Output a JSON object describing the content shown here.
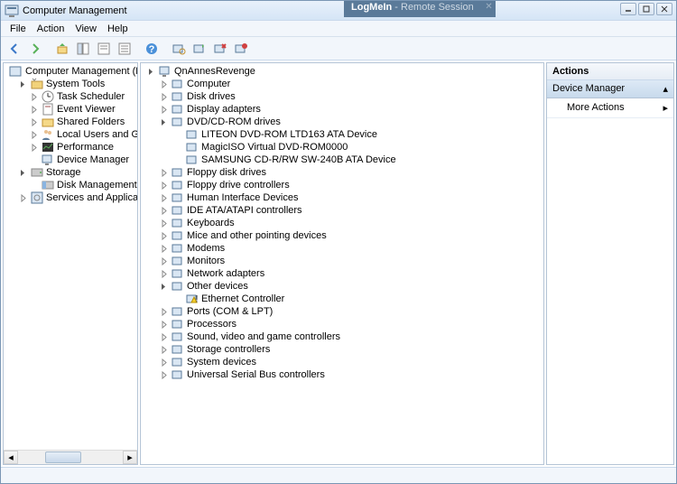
{
  "window": {
    "title": "Computer Management",
    "remote_app": "LogMeIn",
    "remote_suffix": " - Remote Session"
  },
  "menu": [
    "File",
    "Action",
    "View",
    "Help"
  ],
  "leftTree": {
    "root": "Computer Management (Local",
    "groups": [
      {
        "label": "System Tools",
        "children": [
          "Task Scheduler",
          "Event Viewer",
          "Shared Folders",
          "Local Users and Groups",
          "Performance",
          "Device Manager"
        ]
      },
      {
        "label": "Storage",
        "children": [
          "Disk Management"
        ]
      },
      {
        "label": "Services and Applications",
        "children": []
      }
    ]
  },
  "devTree": {
    "root": "QnAnnesRevenge",
    "cats": [
      {
        "label": "Computer"
      },
      {
        "label": "Disk drives"
      },
      {
        "label": "Display adapters"
      },
      {
        "label": "DVD/CD-ROM drives",
        "expanded": true,
        "children": [
          "LITEON DVD-ROM LTD163 ATA Device",
          "MagicISO Virtual DVD-ROM0000",
          "SAMSUNG CD-R/RW SW-240B ATA Device"
        ]
      },
      {
        "label": "Floppy disk drives"
      },
      {
        "label": "Floppy drive controllers"
      },
      {
        "label": "Human Interface Devices"
      },
      {
        "label": "IDE ATA/ATAPI controllers"
      },
      {
        "label": "Keyboards"
      },
      {
        "label": "Mice and other pointing devices"
      },
      {
        "label": "Modems"
      },
      {
        "label": "Monitors"
      },
      {
        "label": "Network adapters"
      },
      {
        "label": "Other devices",
        "expanded": true,
        "warn": true,
        "children": [
          "Ethernet Controller"
        ]
      },
      {
        "label": "Ports (COM & LPT)"
      },
      {
        "label": "Processors"
      },
      {
        "label": "Sound, video and game controllers"
      },
      {
        "label": "Storage controllers"
      },
      {
        "label": "System devices"
      },
      {
        "label": "Universal Serial Bus controllers"
      }
    ]
  },
  "actions": {
    "header": "Actions",
    "section": "Device Manager",
    "more": "More Actions"
  }
}
